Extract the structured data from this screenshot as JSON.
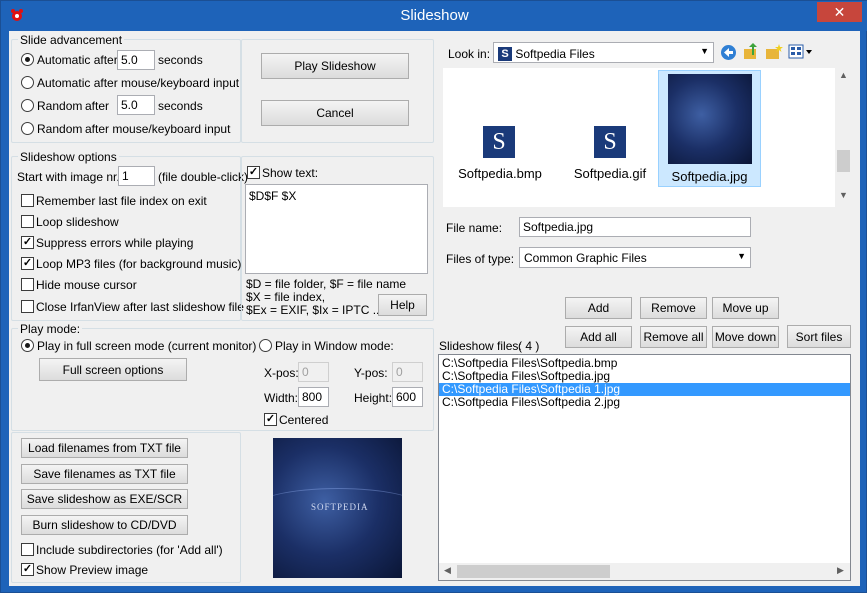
{
  "window": {
    "title": "Slideshow",
    "close_glyph": "✕"
  },
  "advancement": {
    "group_label": "Slide advancement",
    "auto_after_label": "Automatic after",
    "auto_after_value": "5.0",
    "seconds_label": "seconds",
    "auto_input_label": "Automatic after mouse/keyboard input",
    "random_label": "Random",
    "random_after_label": "after",
    "random_value": "5.0",
    "random_seconds_label": "seconds",
    "random_input_label1": "Random",
    "random_input_label2": "after mouse/keyboard input"
  },
  "buttons": {
    "play": "Play Slideshow",
    "cancel": "Cancel"
  },
  "options": {
    "group_label": "Slideshow options",
    "start_label": "Start with image nr.:",
    "start_value": "1",
    "start_hint": "(file double-click)",
    "remember": "Remember last file index on exit",
    "loop": "Loop slideshow",
    "suppress": "Suppress errors while playing",
    "loop_mp3": "Loop MP3 files (for background music)",
    "hide_cursor": "Hide mouse cursor",
    "close_irfan": "Close IrfanView after last slideshow file",
    "show_text_label": "Show text:",
    "show_text_value": "$D$F $X",
    "help_line1": "$D = file folder, $F = file name",
    "help_line2": "$X = file index,",
    "help_line3": "$Ex = EXIF, $Ix = IPTC ...",
    "help_button": "Help"
  },
  "play_mode": {
    "group_label": "Play mode:",
    "fullscreen_label": "Play in full screen mode (current monitor)",
    "fullscreen_options": "Full screen options",
    "window_label": "Play in Window mode:",
    "xpos_label": "X-pos:",
    "xpos_value": "0",
    "ypos_label": "Y-pos:",
    "ypos_value": "0",
    "width_label": "Width:",
    "width_value": "800",
    "height_label": "Height:",
    "height_value": "600",
    "centered_label": "Centered"
  },
  "file_buttons": {
    "load": "Load filenames from TXT file",
    "save": "Save filenames as TXT file",
    "save_exe": "Save slideshow as  EXE/SCR",
    "burn": "Burn slideshow to CD/DVD",
    "include_sub": "Include subdirectories (for 'Add all')",
    "show_preview": "Show Preview image"
  },
  "preview": {
    "logo_text": "SOFTPEDIA"
  },
  "browser": {
    "look_in_label": "Look in:",
    "look_in_value": "Softpedia Files",
    "files": [
      {
        "name": "Softpedia.bmp",
        "glyph": "S"
      },
      {
        "name": "Softpedia.gif",
        "glyph": "S"
      },
      {
        "name": "Softpedia.jpg",
        "glyph": ""
      }
    ],
    "filename_label": "File name:",
    "filename_value": "Softpedia.jpg",
    "type_label": "Files of type:",
    "type_value": "Common Graphic Files"
  },
  "list_actions": {
    "add": "Add",
    "remove": "Remove",
    "move_up": "Move up",
    "add_all": "Add all",
    "remove_all": "Remove all",
    "move_down": "Move down",
    "sort": "Sort files"
  },
  "slideshow_files": {
    "label": "Slideshow files:",
    "count": "( 4 )",
    "items": [
      "C:\\Softpedia Files\\Softpedia.bmp",
      "C:\\Softpedia Files\\Softpedia.jpg",
      "C:\\Softpedia Files\\Softpedia 1.jpg",
      "C:\\Softpedia Files\\Softpedia 2.jpg"
    ],
    "selected_index": 2
  },
  "colors": {
    "titlebar": "#1e63b9",
    "selection": "#3399ff",
    "close": "#c7463c",
    "softpedia_blue": "#1a3a7a"
  }
}
